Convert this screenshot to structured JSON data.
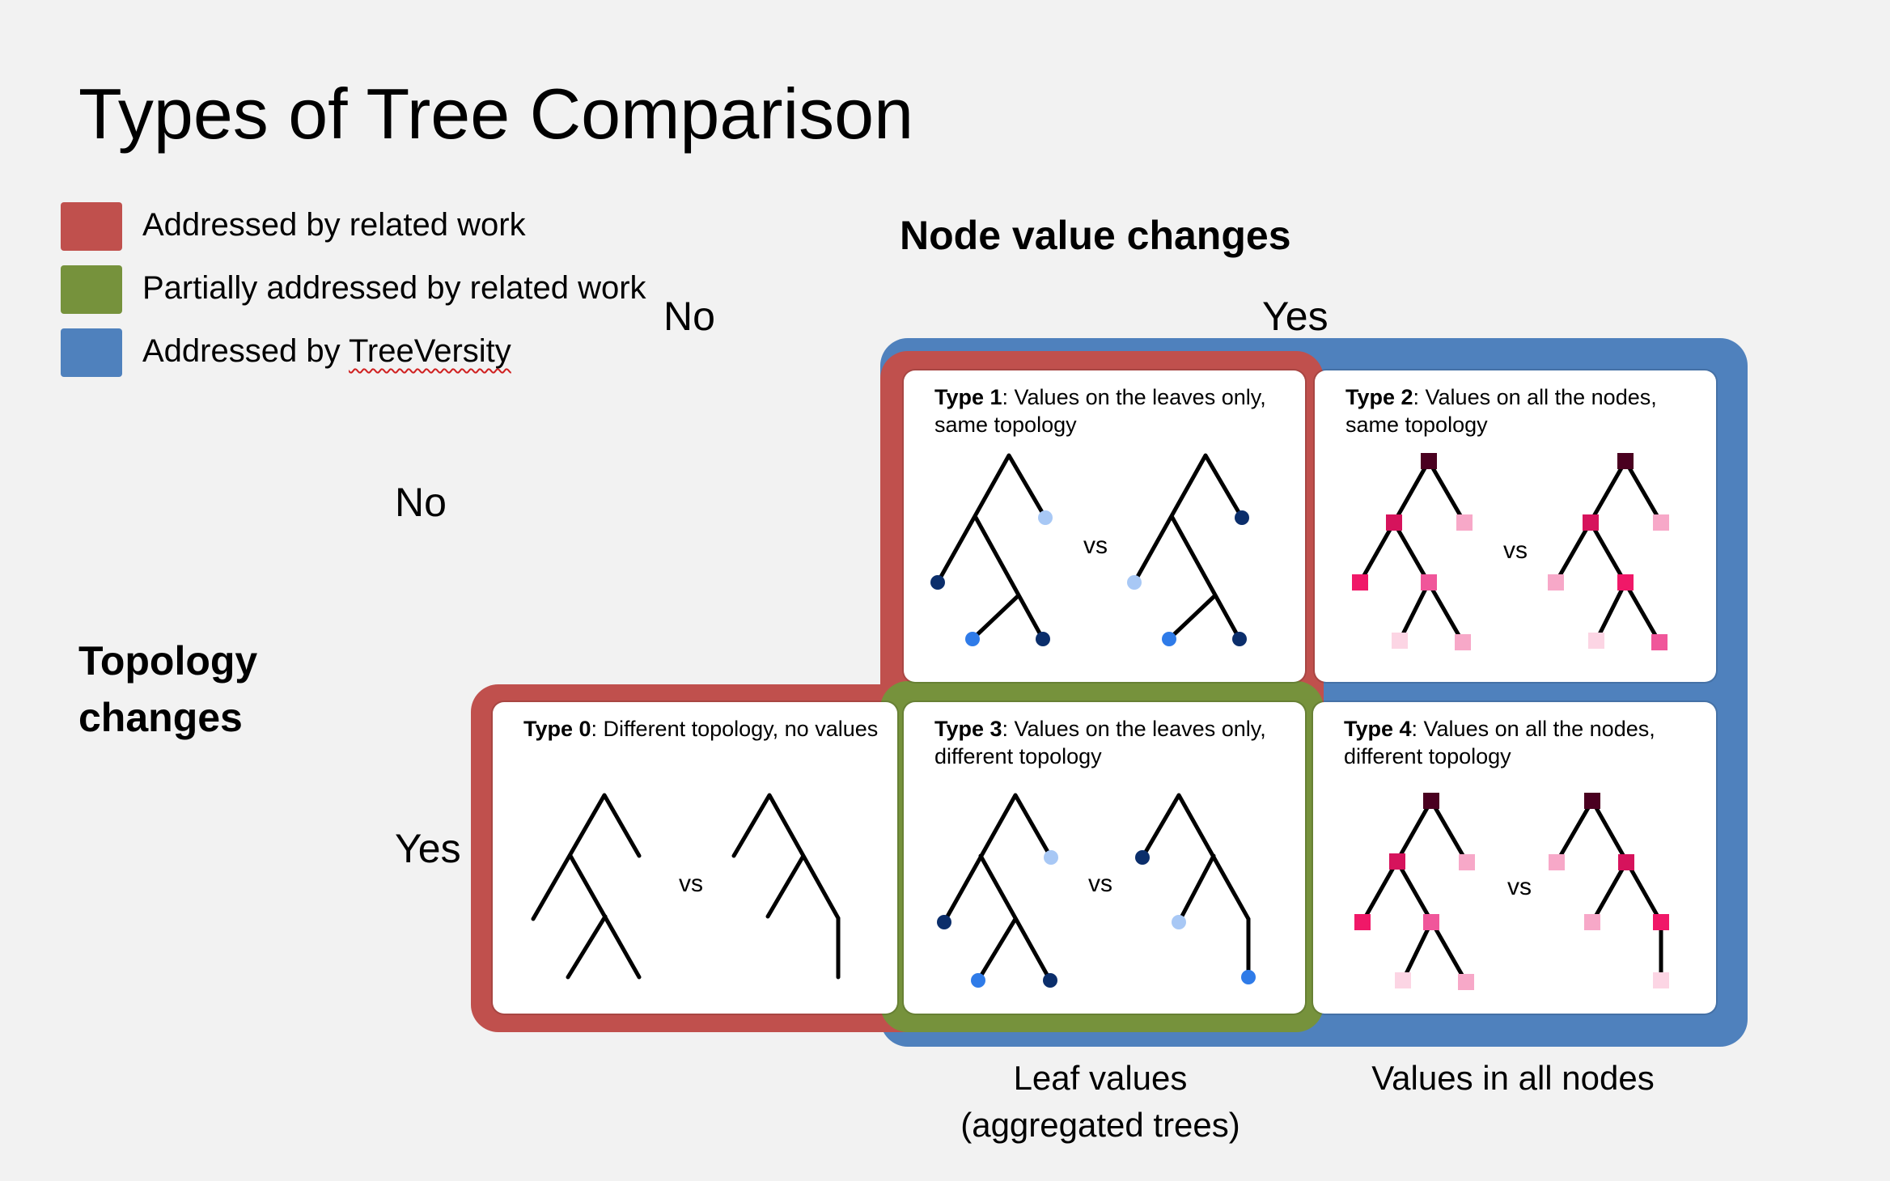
{
  "title": "Types of Tree Comparison",
  "legend": {
    "items": [
      {
        "label": "Addressed by related work",
        "color": "#c0504d"
      },
      {
        "label": "Partially addressed by related work",
        "color": "#76923c"
      },
      {
        "label": "Addressed by ",
        "label_underlined": "TreeVersity",
        "color": "#4f81bd"
      }
    ]
  },
  "node_value_changes": {
    "heading": "Node value changes",
    "no": "No",
    "yes": "Yes"
  },
  "topology_changes": {
    "heading_line1": "Topology",
    "heading_line2": "changes",
    "no": "No",
    "yes": "Yes"
  },
  "footer": {
    "leaf_values_line1": "Leaf values",
    "leaf_values_line2": "(aggregated trees)",
    "all_nodes": "Values in all nodes"
  },
  "panels": {
    "type0": {
      "type_label": "Type 0",
      "desc": ": Different topology, no values",
      "vs": "vs"
    },
    "type1": {
      "type_label": "Type 1",
      "desc": ": Values on the leaves only, same topology",
      "vs": "vs"
    },
    "type2": {
      "type_label": "Type 2",
      "desc": ": Values on all the nodes, same topology",
      "vs": "vs"
    },
    "type3": {
      "type_label": "Type 3",
      "desc": ": Values on the leaves only, different topology",
      "vs": "vs"
    },
    "type4": {
      "type_label": "Type 4",
      "desc": ": Values on all the nodes, different topology",
      "vs": "vs"
    }
  },
  "colors": {
    "red_region": "#c0504d",
    "green_region": "#76923c",
    "blue_region": "#4f81bd",
    "leaf_dark_blue": "#0b2e6b",
    "leaf_mid_blue": "#2f7be8",
    "leaf_light_blue": "#a8c8f5",
    "node_darkest": "#4a0020",
    "node_dark_pink": "#d6135c",
    "node_mid_pink": "#f0569a",
    "node_light_pink": "#f7a8c8",
    "node_lightest_pink": "#fcd5e4"
  }
}
